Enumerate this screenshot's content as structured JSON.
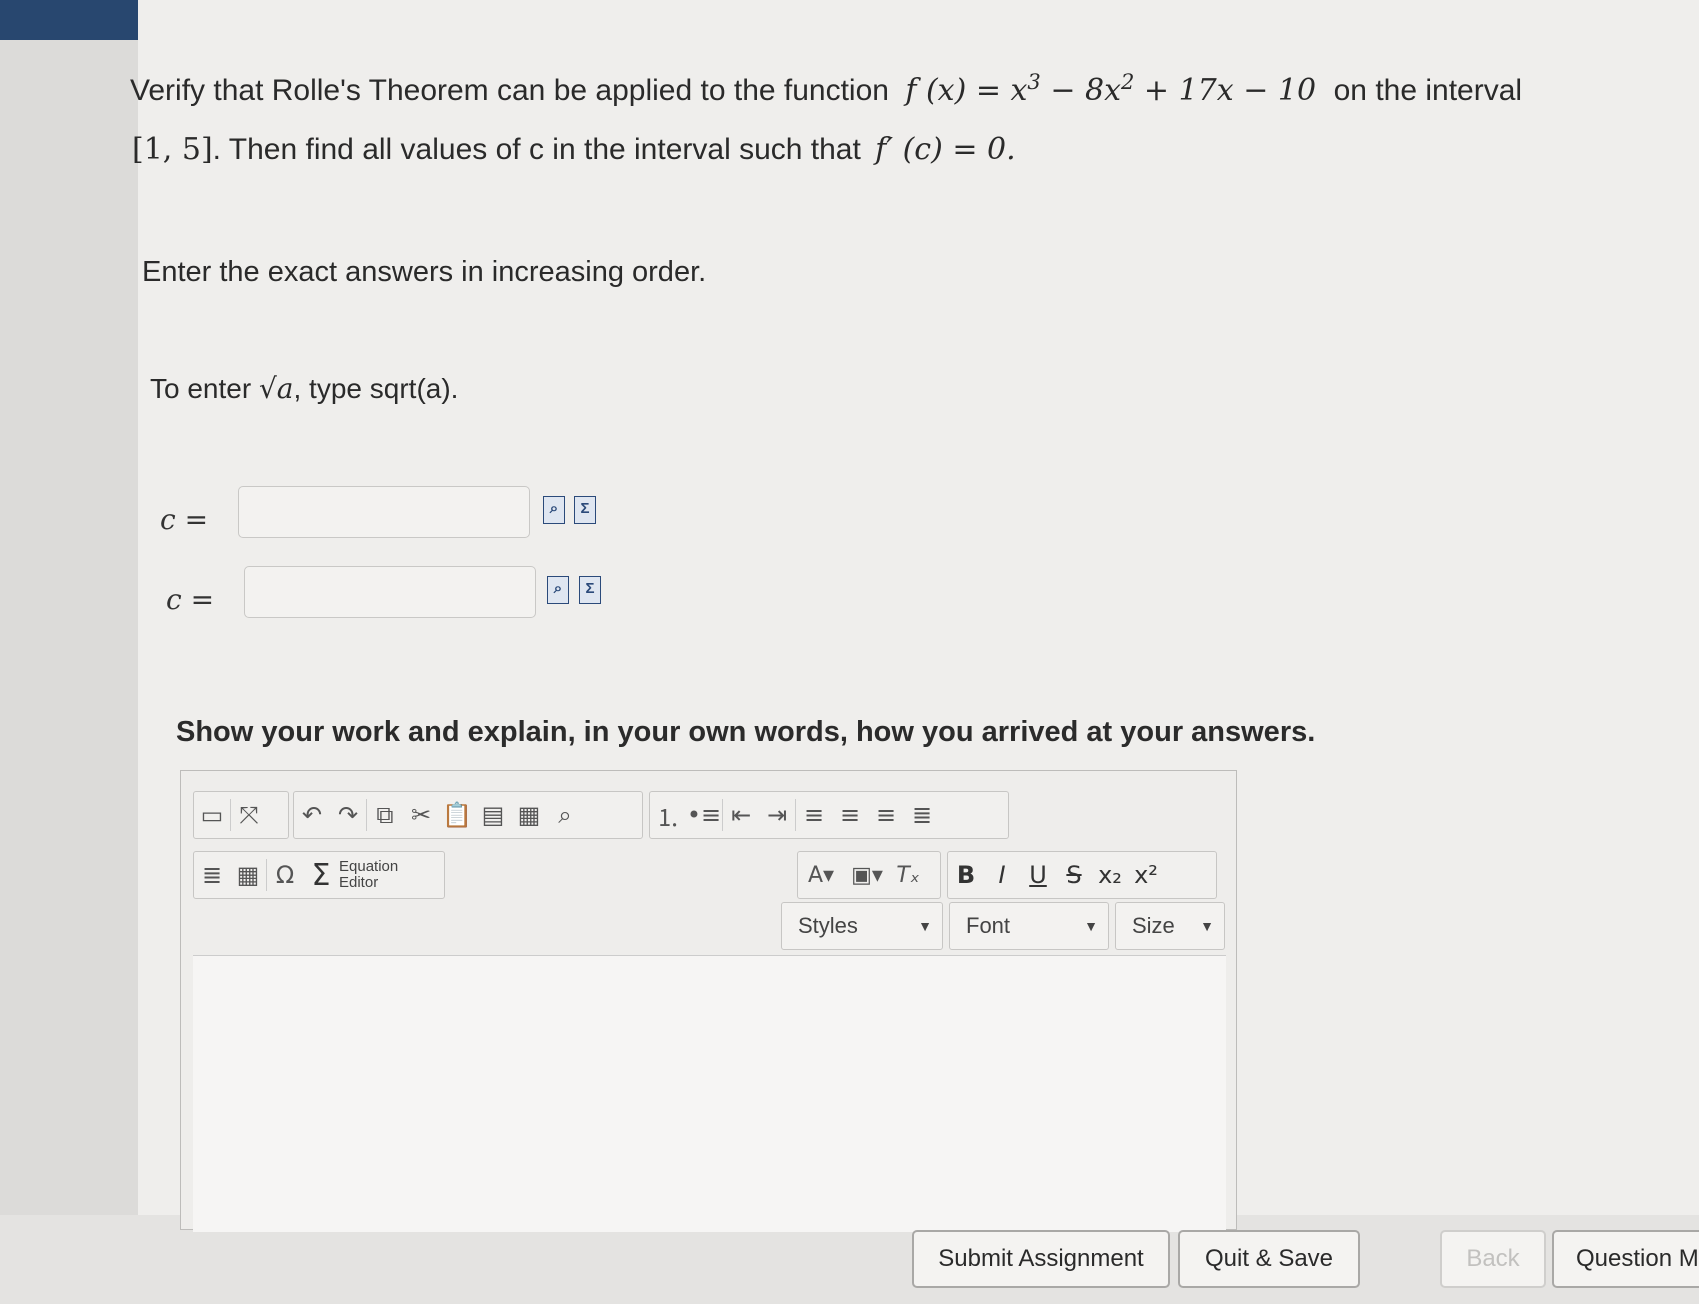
{
  "question": {
    "line1_prefix": "Verify that Rolle's Theorem can be applied to the function",
    "func_lhs": "f (x) =",
    "func_rhs_a": "x",
    "exp3": "3",
    "func_rhs_b": " − 8x",
    "exp2": "2",
    "func_rhs_c": " + 17x − 10",
    "line1_suffix": "on the interval",
    "interval": "[1, 5]",
    "line2_text": ". Then find all values of c in the interval such that",
    "deriv": "f′ (c) = 0.",
    "instruction": "Enter the exact answers in increasing order.",
    "sqrt_prefix": "To enter",
    "sqrt_symbol": "√a",
    "sqrt_suffix": ", type sqrt(a)."
  },
  "answers": [
    {
      "label": "c =",
      "value": ""
    },
    {
      "label": "c =",
      "value": ""
    }
  ],
  "work_prompt": "Show your work and explain, in your own words, how you arrived at your answers.",
  "toolbar": {
    "equation_editor_line1": "Equation",
    "equation_editor_line2": "Editor",
    "styles": "Styles",
    "font": "Font",
    "size": "Size",
    "bold": "B",
    "italic": "I",
    "underline": "U",
    "strike": "S"
  },
  "footer": {
    "submit": "Submit Assignment",
    "quit_save": "Quit & Save",
    "back": "Back",
    "question": "Question M"
  }
}
